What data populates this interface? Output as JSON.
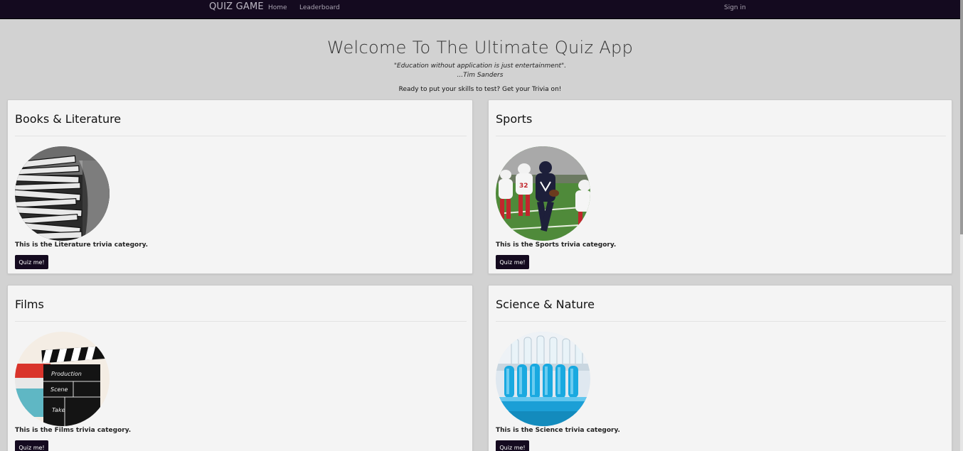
{
  "navbar": {
    "brand": "QUIZ GAME",
    "links": [
      "Home",
      "Leaderboard"
    ],
    "sign_in": "Sign in"
  },
  "hero": {
    "title": "Welcome To The Ultimate Quiz App",
    "quote": "\"Education without application is just entertainment\".",
    "author": "...Tim Sanders",
    "tagline": "Ready to put your skills to test? Get your Trivia on!"
  },
  "categories": [
    {
      "title": "Books & Literature",
      "description": "This is the Literature trivia category.",
      "button": "Quiz me!",
      "image": "stack-of-books-photo"
    },
    {
      "title": "Sports",
      "description": "This is the Sports trivia category.",
      "button": "Quiz me!",
      "image": "football-players-photo"
    },
    {
      "title": "Films",
      "description": "This is the Films trivia category.",
      "button": "Quiz me!",
      "image": "film-clapperboard-photo"
    },
    {
      "title": "Science & Nature",
      "description": "This is the Science trivia category.",
      "button": "Quiz me!",
      "image": "test-tubes-photo"
    }
  ],
  "clapperboard_text": [
    "Production",
    "Scene",
    "Take"
  ],
  "colors": {
    "navbar": "#140a1f",
    "background": "#d2d2d2",
    "card": "#f4f4f4",
    "button": "#140a1f"
  }
}
